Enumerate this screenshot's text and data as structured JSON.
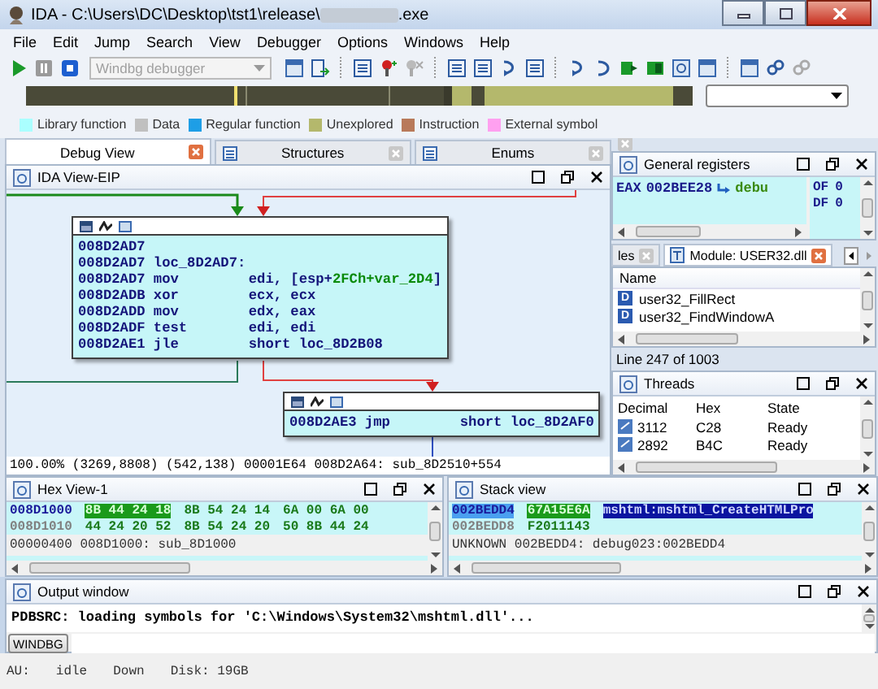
{
  "window": {
    "title": "IDA - C:\\Users\\DC\\Desktop\\tst1\\release\\",
    "title_suffix": ".exe"
  },
  "menu": [
    "File",
    "Edit",
    "Jump",
    "Search",
    "View",
    "Debugger",
    "Options",
    "Windows",
    "Help"
  ],
  "toolbar": {
    "debugger_select": {
      "value": "Windbg debugger",
      "disabled": true
    }
  },
  "legend": [
    {
      "label": "Library function",
      "color": "#aaffff"
    },
    {
      "label": "Data",
      "color": "#c0c0c0"
    },
    {
      "label": "Regular function",
      "color": "#1e9ee6"
    },
    {
      "label": "Unexplored",
      "color": "#b4b86c"
    },
    {
      "label": "Instruction",
      "color": "#b87a5a"
    },
    {
      "label": "External symbol",
      "color": "#ffa0f0"
    }
  ],
  "tabs": [
    {
      "label": "Debug View",
      "selected": true
    },
    {
      "label": "Structures",
      "selected": false
    },
    {
      "label": "Enums",
      "selected": false
    }
  ],
  "ida_view": {
    "title": "IDA View-EIP",
    "blocks": [
      {
        "lines": [
          {
            "address": "008D2AD7"
          },
          {
            "address": "008D2AD7",
            "label": "loc_8D2AD7:"
          },
          {
            "address": "008D2AD7",
            "mnemonic": "mov",
            "operands": [
              {
                "text": "edi, [esp+",
                "kind": "plain"
              },
              {
                "text": "2FCh+var_2D4",
                "kind": "var"
              },
              {
                "text": "]",
                "kind": "plain"
              }
            ]
          },
          {
            "address": "008D2ADB",
            "mnemonic": "xor",
            "operands": [
              {
                "text": "ecx, ecx",
                "kind": "plain"
              }
            ]
          },
          {
            "address": "008D2ADD",
            "mnemonic": "mov",
            "operands": [
              {
                "text": "edx, eax",
                "kind": "plain"
              }
            ]
          },
          {
            "address": "008D2ADF",
            "mnemonic": "test",
            "operands": [
              {
                "text": "edi, edi",
                "kind": "plain"
              }
            ]
          },
          {
            "address": "008D2AE1",
            "mnemonic": "jle",
            "operands": [
              {
                "text": "short loc_8D2B08",
                "kind": "plain"
              }
            ]
          }
        ]
      },
      {
        "lines": [
          {
            "address": "008D2AE3",
            "mnemonic": "jmp",
            "operands": [
              {
                "text": "short loc_8D2AF0",
                "kind": "plain"
              }
            ]
          }
        ]
      }
    ],
    "status": "100.00% (3269,8808) (542,138) 00001E64 008D2A64: sub_8D2510+554"
  },
  "registers": {
    "title": "General registers",
    "rows": [
      {
        "name": "EAX",
        "value": "002BEE28",
        "comment": "debu"
      }
    ],
    "flags": [
      {
        "name": "OF",
        "value": "0"
      },
      {
        "name": "DF",
        "value": "0"
      }
    ]
  },
  "module": {
    "tabs": [
      {
        "label": "les",
        "selected": false
      },
      {
        "label": "Module: USER32.dll",
        "selected": true
      }
    ],
    "column": "Name",
    "rows": [
      {
        "badge": "D",
        "name": "user32_FillRect"
      },
      {
        "badge": "D",
        "name": "user32_FindWindowA"
      }
    ],
    "status": "Line 247 of 1003"
  },
  "threads": {
    "title": "Threads",
    "columns": [
      "Decimal",
      "Hex",
      "State"
    ],
    "rows": [
      {
        "decimal": "3112",
        "hex": "C28",
        "state": "Ready"
      },
      {
        "decimal": "2892",
        "hex": "B4C",
        "state": "Ready"
      }
    ]
  },
  "hex_view": {
    "title": "Hex View-1",
    "rows": [
      {
        "address": "008D1000",
        "selected": true,
        "groups": [
          {
            "text": "8B 44 24 18",
            "highlighted": true
          },
          {
            "text": "8B 54 24 14",
            "highlighted": false
          },
          {
            "text": "6A 00 6A 00",
            "highlighted": false
          }
        ]
      },
      {
        "address": "008D1010",
        "selected": false,
        "groups": [
          {
            "text": "44 24 20 52",
            "highlighted": false
          },
          {
            "text": "8B 54 24 20",
            "highlighted": false
          },
          {
            "text": "50 8B 44 24",
            "highlighted": false
          }
        ]
      }
    ],
    "status": "00000400 008D1000: sub_8D1000"
  },
  "stack_view": {
    "title": "Stack view",
    "rows": [
      {
        "address": "002BEDD4",
        "value": "67A15E6A",
        "comment": "mshtml:mshtml_CreateHTMLPro",
        "selected": true
      },
      {
        "address": "002BEDD8",
        "value": "F2011143",
        "selected": false
      }
    ],
    "status": "UNKNOWN 002BEDD4: debug023:002BEDD4"
  },
  "output": {
    "title": "Output window",
    "text": "PDBSRC: loading symbols for 'C:\\Windows\\System32\\mshtml.dll'...",
    "button": "WINDBG"
  },
  "status_bar": [
    "AU:",
    "idle",
    "Down",
    "Disk: 19GB"
  ]
}
